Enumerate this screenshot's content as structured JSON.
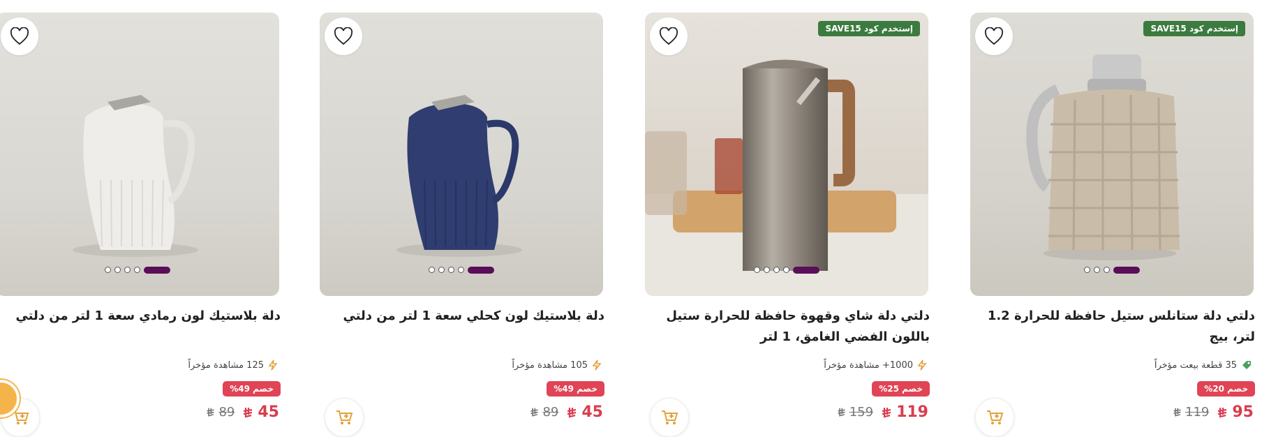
{
  "products": [
    {
      "title": "دلة بلاستيك لون رمادي سعة 1 لتر من دلتي",
      "meta_icon": "lightning-icon",
      "meta": "125 مشاهدة مؤخراً",
      "discount": "خصم 49%",
      "price": "45",
      "old_price": "89",
      "promo": null
    },
    {
      "title": "دلة بلاستيك لون كحلي سعة 1 لتر من دلتي",
      "meta_icon": "lightning-icon",
      "meta": "105 مشاهدة مؤخراً",
      "discount": "خصم 49%",
      "price": "45",
      "old_price": "89",
      "promo": null
    },
    {
      "title": "دلتي دلة شاي وقهوة حافظة للحرارة ستيل باللون الفضي الغامق، 1 لتر",
      "meta_icon": "lightning-icon",
      "meta": "1000+ مشاهدة مؤخراً",
      "discount": "خصم 25%",
      "price": "119",
      "old_price": "159",
      "promo": "إستخدم كود SAVE15"
    },
    {
      "title": "دلتي دلة ستانلس ستيل حافظة للحرارة 1.2 لتر، بيج",
      "meta_icon": "tag-icon",
      "meta": "35 قطعة بيعت مؤخراً",
      "discount": "خصم 20%",
      "price": "95",
      "old_price": "119",
      "promo": "إستخدم كود SAVE15"
    }
  ],
  "colors": {
    "price": "#d93d4f",
    "discount_bg": "#e04455",
    "promo_bg": "#3b7b3f",
    "slider_active": "#5a0d59",
    "cart_icon": "#e3a13a"
  },
  "icons": {
    "wishlist": "heart-outline-icon",
    "cart": "cart-plus-icon",
    "currency": "riyal-icon"
  }
}
